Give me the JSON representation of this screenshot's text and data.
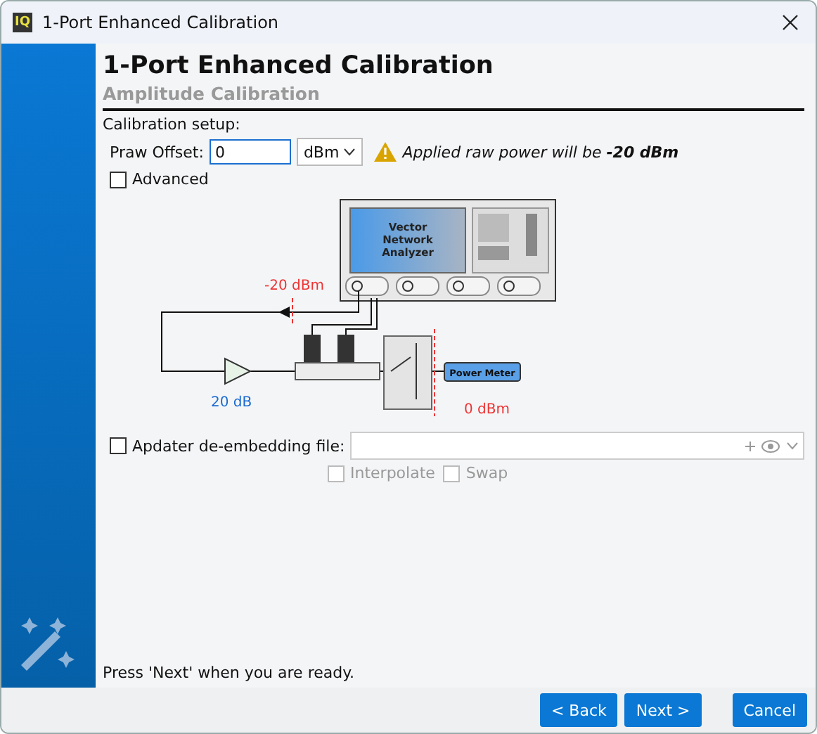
{
  "window": {
    "title": "1-Port Enhanced Calibration",
    "logo": "IQ"
  },
  "header": {
    "title": "1-Port Enhanced Calibration",
    "subtitle": "Amplitude Calibration"
  },
  "setup_label": "Calibration setup:",
  "offset": {
    "label": "Praw Offset:",
    "value": "0",
    "unit": "dBm"
  },
  "warning": "Applied raw power will be **-20 dBm**",
  "advanced": {
    "label": "Advanced",
    "checked": false
  },
  "diagram": {
    "analyzer_lines": [
      "Vector",
      "Network",
      "Analyzer"
    ],
    "input_level": "-20 dBm",
    "gain": "20 dB",
    "meter": "Power Meter",
    "meter_level": "0 dBm"
  },
  "deembed": {
    "label": "Apdater de-embedding file:",
    "checked": false,
    "options": [
      {
        "label": "Interpolate",
        "checked": false,
        "disabled": true
      },
      {
        "label": "Swap",
        "checked": false,
        "disabled": true
      }
    ]
  },
  "status": "Press 'Next' when you are ready.",
  "buttons": [
    {
      "label": "< Back",
      "disabled": false
    },
    {
      "label": "Next >",
      "disabled": false
    },
    {
      "label": "Cancel",
      "disabled": false
    }
  ]
}
